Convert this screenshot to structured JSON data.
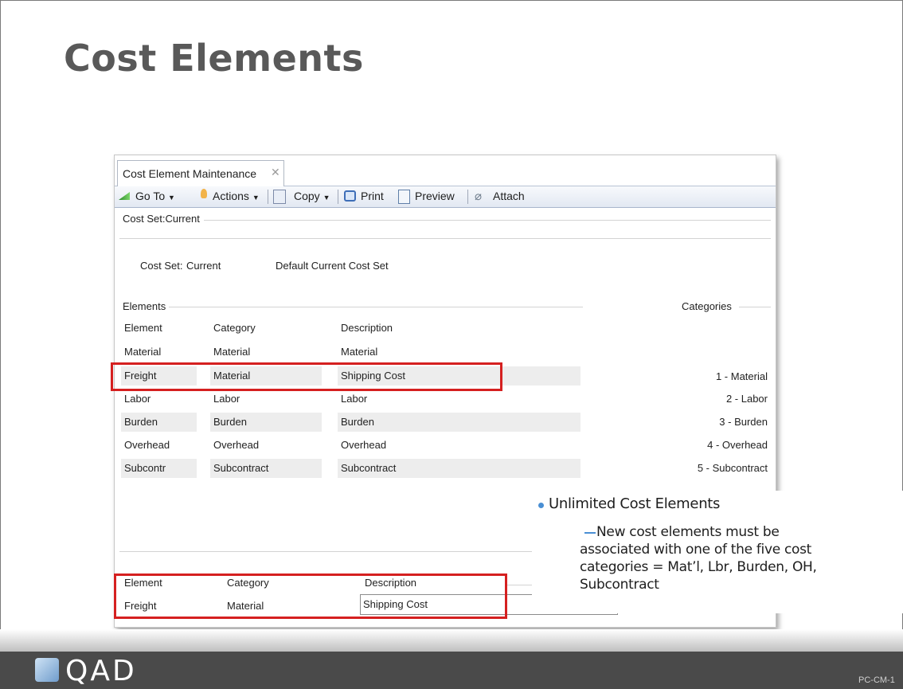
{
  "slide": {
    "title": "Cost Elements",
    "footer_logo": "QAD",
    "slide_code": "PC-CM-1"
  },
  "window": {
    "tab_label": "Cost Element Maintenance",
    "tab_close": "✕",
    "toolbar": {
      "goto": "Go To",
      "actions": "Actions",
      "copy": "Copy",
      "print": "Print",
      "preview": "Preview",
      "attach": "Attach",
      "dropdown_caret": "▼"
    },
    "cost_set_group_label": "Cost Set:Current",
    "cost_set_label": "Cost Set:",
    "cost_set_value": "Current",
    "cost_set_description": "Default Current Cost Set",
    "elements_group_label": "Elements",
    "categories_group_label": "Categories",
    "table": {
      "headers": [
        "Element",
        "Category",
        "Description"
      ],
      "rows": [
        [
          "Material",
          "Material",
          "Material"
        ],
        [
          "Freight",
          "Material",
          "Shipping Cost"
        ],
        [
          "Labor",
          "Labor",
          "Labor"
        ],
        [
          "Burden",
          "Burden",
          "Burden"
        ],
        [
          "Overhead",
          "Overhead",
          "Overhead"
        ],
        [
          "Subcontr",
          "Subcontract",
          "Subcontract"
        ]
      ]
    },
    "categories": [
      "1 - Material",
      "2 - Labor",
      "3 - Burden",
      "4 - Overhead",
      "5 - Subcontract"
    ],
    "detail": {
      "element_label": "Element",
      "category_label": "Category",
      "description_label": "Description",
      "element_value": "Freight",
      "category_value": "Material",
      "description_value": "Shipping Cost"
    }
  },
  "callout": {
    "bullet": "Unlimited Cost Elements",
    "sub_bullet": "New cost elements must be associated with one of the five cost categories = Mat’l, Lbr, Burden, OH, Subcontract"
  },
  "colors": {
    "highlight_red": "#d52020",
    "bullet_blue": "#4a8fd4",
    "footer_dark": "#4a4a4a"
  }
}
